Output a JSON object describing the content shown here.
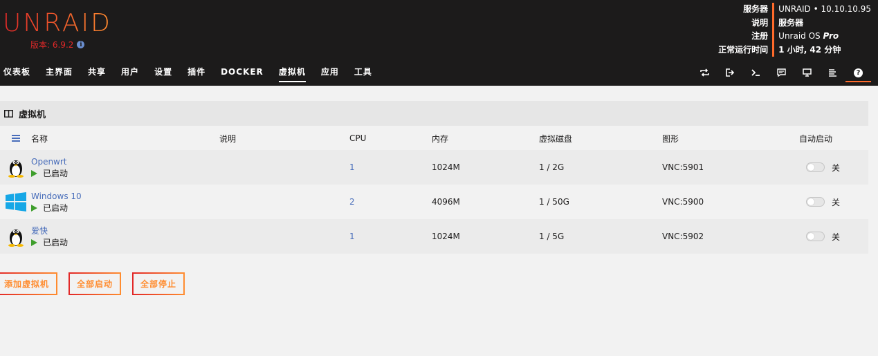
{
  "header": {
    "logo": "UNRAID",
    "version": "版本: 6.9.2",
    "server": {
      "labels": [
        "服务器",
        "说明",
        "注册",
        "正常运行时间"
      ],
      "server_value": "UNRAID • 10.10.10.95",
      "description_value": "服务器",
      "registration_os": "Unraid OS",
      "registration_plan": "Pro",
      "uptime_value": "1 小时, 42 分钟"
    },
    "nav": [
      "仪表板",
      "主界面",
      "共享",
      "用户",
      "设置",
      "插件",
      "DOCKER",
      "虚拟机",
      "应用",
      "工具"
    ],
    "nav_active": "虚拟机",
    "nav_icons": [
      "refresh-icon",
      "logout-icon",
      "terminal-icon",
      "feedback-icon",
      "monitor-icon",
      "log-icon",
      "help-icon"
    ],
    "help_glyph": "?"
  },
  "panel": {
    "title": "虚拟机"
  },
  "table": {
    "columns": {
      "name": "名称",
      "description": "说明",
      "cpu": "CPU",
      "memory": "内存",
      "disk": "虚拟磁盘",
      "graphics": "图形",
      "autostart": "自动启动"
    },
    "rows": [
      {
        "os_icon": "linux-tux-icon",
        "name": "Openwrt",
        "status": "已启动",
        "description": "",
        "cpu": "1",
        "memory": "1024M",
        "disk": "1 / 2G",
        "graphics": "VNC:5901",
        "autostart": "关"
      },
      {
        "os_icon": "windows-icon",
        "name": "Windows 10",
        "status": "已启动",
        "description": "",
        "cpu": "2",
        "memory": "4096M",
        "disk": "1 / 50G",
        "graphics": "VNC:5900",
        "autostart": "关"
      },
      {
        "os_icon": "linux-tux-icon",
        "name": "爱快",
        "status": "已启动",
        "description": "",
        "cpu": "1",
        "memory": "1024M",
        "disk": "1 / 5G",
        "graphics": "VNC:5902",
        "autostart": "关"
      }
    ]
  },
  "buttons": {
    "add_vm": "添加虚拟机",
    "start_all": "全部启动",
    "stop_all": "全部停止"
  },
  "colors": {
    "header_bg": "#1c1b1b",
    "accent_red": "#e22828",
    "accent_orange": "#ff8c2f",
    "link_blue": "#486dba",
    "status_green": "#3e9e2c"
  }
}
